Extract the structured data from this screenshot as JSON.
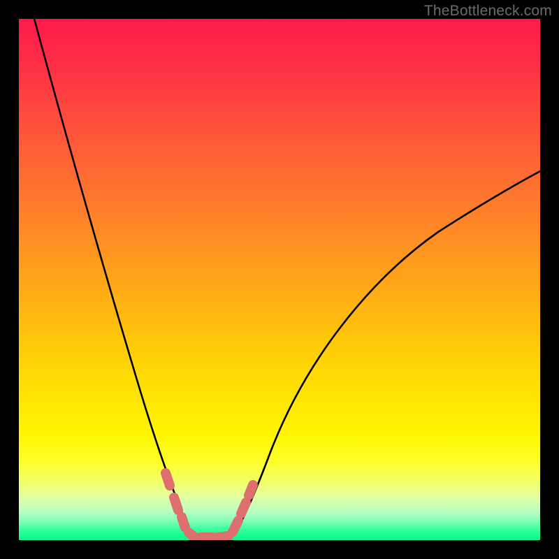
{
  "watermark": "TheBottleneck.com",
  "colors": {
    "frame": "#000000",
    "curve": "#000000",
    "marker": "#e07070",
    "gradient_top": "#ff1a49",
    "gradient_bottom": "#08f58c"
  },
  "chart_data": {
    "type": "line",
    "title": "",
    "xlabel": "",
    "ylabel": "",
    "xlim": [
      0,
      100
    ],
    "ylim": [
      0,
      100
    ],
    "grid": false,
    "note": "Bottleneck-style notch curve. y approximates vertical position as percentage from top (0 = top, 100 = bottom). Valley floor around x≈33–40 at y≈100.",
    "series": [
      {
        "name": "left_arm",
        "x": [
          3,
          6,
          9,
          12,
          15,
          18,
          21,
          24,
          27,
          29,
          31,
          33
        ],
        "y": [
          0,
          16,
          30,
          42,
          53,
          62,
          70,
          78,
          85,
          91,
          96,
          100
        ]
      },
      {
        "name": "valley_floor",
        "x": [
          33,
          35,
          37,
          39,
          40
        ],
        "y": [
          100,
          100,
          100,
          100,
          100
        ]
      },
      {
        "name": "right_arm",
        "x": [
          40,
          42,
          45,
          48,
          52,
          56,
          60,
          65,
          70,
          75,
          80,
          85,
          90,
          95,
          100
        ],
        "y": [
          100,
          97,
          92,
          86,
          79,
          72,
          66,
          59,
          53,
          48,
          43,
          39,
          35,
          32,
          29
        ]
      }
    ],
    "markers": {
      "name": "highlighted_points",
      "shape": "rounded_capsule",
      "color": "#e07070",
      "points_xy": [
        [
          28.5,
          88
        ],
        [
          30.0,
          92
        ],
        [
          31.2,
          95.5
        ],
        [
          32.8,
          98.5
        ],
        [
          35.0,
          99.5
        ],
        [
          37.5,
          99.5
        ],
        [
          39.8,
          99
        ],
        [
          41.5,
          96.5
        ],
        [
          42.8,
          93.5
        ],
        [
          44.0,
          90.5
        ]
      ]
    }
  }
}
